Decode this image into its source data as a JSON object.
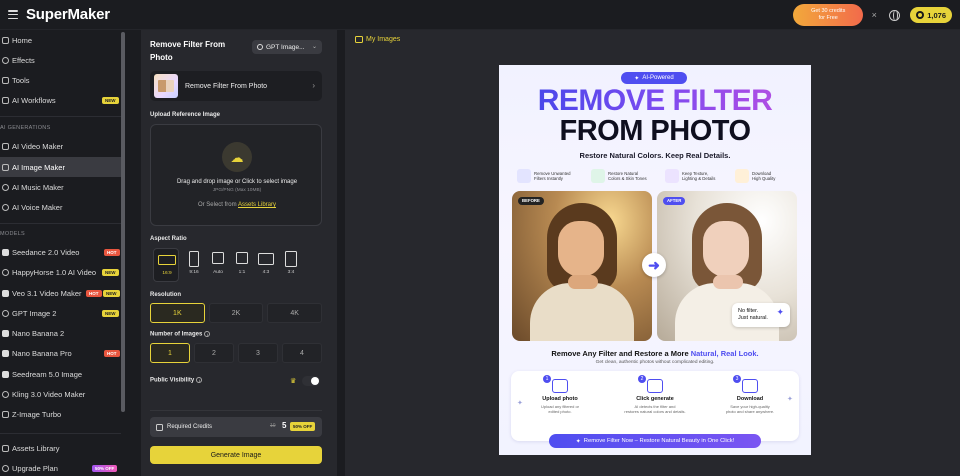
{
  "app": {
    "logo": "SuperMaker",
    "promo": {
      "line1": "Get 30 credits",
      "line2": "for Free"
    },
    "credits": "1,076",
    "colors": {
      "accent": "#e7d33a",
      "brand": "#4f4ef0",
      "hot": "#e8563f"
    }
  },
  "sidebar": {
    "items_top": [
      {
        "label": "Home",
        "icon": "home-icon"
      },
      {
        "label": "Effects",
        "icon": "effects-icon"
      },
      {
        "label": "Tools",
        "icon": "tools-icon"
      },
      {
        "label": "AI Workflows",
        "icon": "workflow-icon",
        "badge": "NEW"
      }
    ],
    "section_gen": "AI GENERATIONS",
    "items_gen": [
      {
        "label": "AI Video Maker",
        "icon": "video-icon"
      },
      {
        "label": "AI Image Maker",
        "icon": "image-icon",
        "active": true
      },
      {
        "label": "AI Music Maker",
        "icon": "music-icon"
      },
      {
        "label": "AI Voice Maker",
        "icon": "voice-icon"
      }
    ],
    "section_models": "MODELS",
    "items_models": [
      {
        "label": "Seedance 2.0 Video",
        "icon": "model-icon",
        "badge": "HOT"
      },
      {
        "label": "HappyHorse 1.0 AI Video",
        "icon": "model-icon",
        "badge": "NEW"
      },
      {
        "label": "Veo 3.1 Video Maker",
        "icon": "model-icon",
        "badge": "HOT",
        "badge2": "NEW"
      },
      {
        "label": "GPT Image 2",
        "icon": "model-icon",
        "badge": "NEW"
      },
      {
        "label": "Nano Banana 2",
        "icon": "model-icon"
      },
      {
        "label": "Nano Banana Pro",
        "icon": "model-icon",
        "badge": "HOT"
      },
      {
        "label": "Seedream 5.0 Image",
        "icon": "model-icon"
      },
      {
        "label": "Kling 3.0 Video Maker",
        "icon": "model-icon"
      },
      {
        "label": "Z-Image Turbo",
        "icon": "model-icon"
      }
    ],
    "items_bottom": [
      {
        "label": "Assets Library",
        "icon": "library-icon"
      },
      {
        "label": "Upgrade Plan",
        "icon": "upgrade-icon",
        "badge": "50% OFF"
      }
    ]
  },
  "panel": {
    "title": "Remove Filter From Photo",
    "model": "GPT Image...",
    "tool_name": "Remove Filter From Photo",
    "upload_label": "Upload Reference Image",
    "upload_main": "Drag and drop image or Click to select image",
    "upload_sub": "JPG/PNG (Max 10MB)",
    "upload_or": "Or Select from",
    "upload_link": "Assets Library",
    "aspect_label": "Aspect Ratio",
    "aspects": [
      "16:9",
      "9:16",
      "Auto",
      "1:1",
      "4:3",
      "3:4"
    ],
    "resolution_label": "Resolution",
    "resolutions": [
      "1K",
      "2K",
      "4K"
    ],
    "num_label": "Number of Images",
    "nums": [
      "1",
      "2",
      "3",
      "4"
    ],
    "visibility_label": "Public Visibility",
    "required_label": "Required Credits",
    "credits_old": "10",
    "credits_new": "5",
    "discount": "50% OFF",
    "generate": "Generate Image"
  },
  "main": {
    "my_images": "My Images"
  },
  "poster": {
    "pill": "AI-Powered",
    "title1": "REMOVE FILTER",
    "title2": "FROM PHOTO",
    "tagline": "Restore Natural Colors. Keep Real Details.",
    "features": [
      {
        "l1": "Remove Unwanted",
        "l2": "Filters Instantly"
      },
      {
        "l1": "Restore Natural",
        "l2": "Colors & Skin Tones"
      },
      {
        "l1": "Keep Texture,",
        "l2": "Lighting & Details"
      },
      {
        "l1": "Download",
        "l2": "High Quality"
      }
    ],
    "before": "BEFORE",
    "after": "AFTER",
    "nofilter1": "No filter.",
    "nofilter2": "Just natural.",
    "h2_pre": "Remove Any Filter and Restore a More ",
    "h2_hl": "Natural, Real Look.",
    "sub": "Get clean, authentic photos without complicated editing.",
    "steps": [
      {
        "n": "1",
        "title": "Upload photo",
        "d1": "Upload any filtered or",
        "d2": "edited photo."
      },
      {
        "n": "2",
        "title": "Click generate",
        "d1": "AI detects the filter and",
        "d2": "restores natural colors and details."
      },
      {
        "n": "3",
        "title": "Download",
        "d1": "Save your high-quality",
        "d2": "photo and share anywhere."
      }
    ],
    "cta": "Remove Filter Now – Restore Natural Beauty in One Click!"
  }
}
